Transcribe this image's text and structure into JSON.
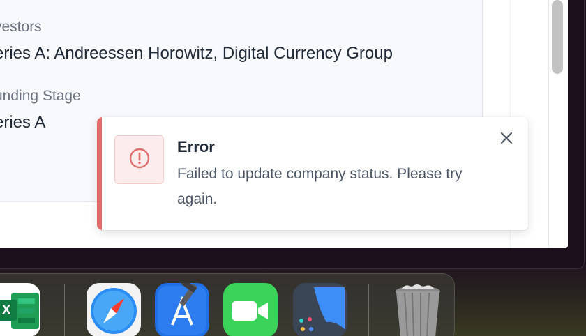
{
  "details": {
    "investors_label": "vestors",
    "investors_value": "eries A: Andreessen Horowitz, Digital Currency Group",
    "funding_stage_label": "unding Stage",
    "funding_stage_value": "eries A"
  },
  "toast": {
    "type": "error",
    "title": "Error",
    "message": "Failed to update company status. Please try again.",
    "accent_color": "#e06c6c",
    "icon": "alert-circle-icon",
    "close_icon": "close-icon"
  },
  "dock": {
    "apps": [
      {
        "name": "Microsoft Excel",
        "icon": "excel-icon",
        "letter": "X"
      },
      {
        "name": "Safari",
        "icon": "safari-icon"
      },
      {
        "name": "Xcode",
        "icon": "xcode-icon"
      },
      {
        "name": "FaceTime",
        "icon": "facetime-icon"
      },
      {
        "name": "Preview",
        "icon": "preview-icon"
      },
      {
        "name": "Trash",
        "icon": "trash-icon"
      }
    ]
  }
}
